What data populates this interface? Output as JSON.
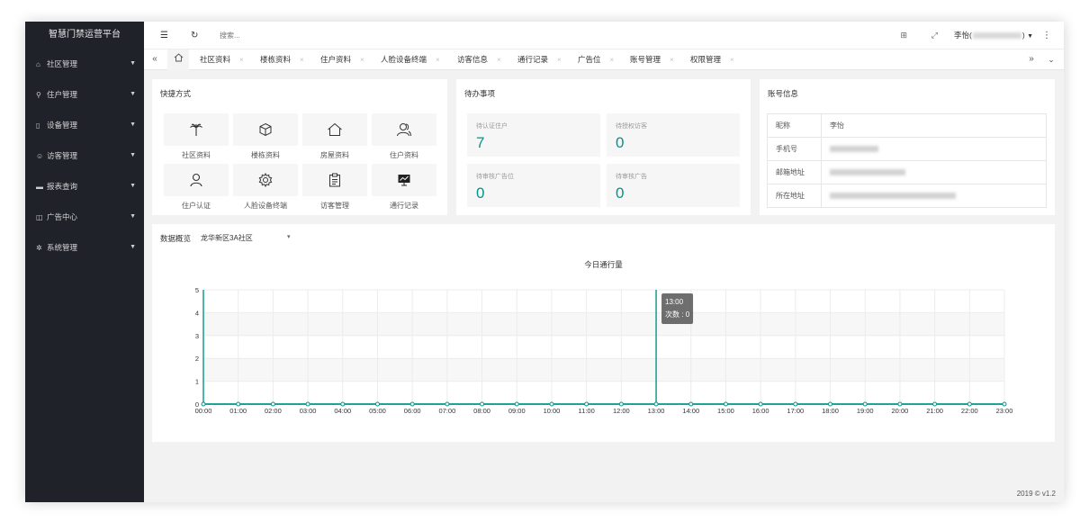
{
  "app": {
    "title": "智慧门禁运营平台",
    "footer": "2019 © v1.2"
  },
  "sidebar": {
    "items": [
      {
        "label": "社区管理",
        "icon": "home-icon"
      },
      {
        "label": "住户管理",
        "icon": "user-icon"
      },
      {
        "label": "设备管理",
        "icon": "tablet-icon"
      },
      {
        "label": "访客管理",
        "icon": "visitors-icon"
      },
      {
        "label": "报表查询",
        "icon": "report-icon"
      },
      {
        "label": "广告中心",
        "icon": "ad-icon"
      },
      {
        "label": "系统管理",
        "icon": "gear-icon"
      }
    ]
  },
  "header": {
    "search_placeholder": "搜索...",
    "user_name": "李怡(",
    "user_suffix": ")"
  },
  "tabs": [
    "社区资料",
    "楼栋资料",
    "住户资料",
    "人脸设备终端",
    "访客信息",
    "通行记录",
    "广告位",
    "账号管理",
    "权限管理"
  ],
  "quick": {
    "title": "快捷方式",
    "items": [
      {
        "label": "社区资料",
        "icon": "palm-tree-icon"
      },
      {
        "label": "楼栋资料",
        "icon": "cube-icon"
      },
      {
        "label": "房屋资料",
        "icon": "house-icon"
      },
      {
        "label": "住户资料",
        "icon": "users-icon"
      },
      {
        "label": "住户认证",
        "icon": "person-icon"
      },
      {
        "label": "人脸设备终端",
        "icon": "gear-icon"
      },
      {
        "label": "访客管理",
        "icon": "clipboard-icon"
      },
      {
        "label": "通行记录",
        "icon": "presentation-icon"
      }
    ]
  },
  "todo": {
    "title": "待办事项",
    "items": [
      {
        "label": "待认证住户",
        "value": "7"
      },
      {
        "label": "待授权访客",
        "value": "0"
      },
      {
        "label": "待审核广告位",
        "value": "0"
      },
      {
        "label": "待审核广告",
        "value": "0"
      }
    ]
  },
  "account": {
    "title": "账号信息",
    "rows": [
      {
        "key": "昵称",
        "value": "李怡"
      },
      {
        "key": "手机号",
        "value": ""
      },
      {
        "key": "邮箱地址",
        "value": ""
      },
      {
        "key": "所在地址",
        "value": ""
      }
    ]
  },
  "overview": {
    "title": "数据概览",
    "community": "龙华新区3A社区"
  },
  "chart_data": {
    "type": "line",
    "title": "今日通行量",
    "x": [
      "00:00",
      "01:00",
      "02:00",
      "03:00",
      "04:00",
      "05:00",
      "06:00",
      "07:00",
      "08:00",
      "09:00",
      "10:00",
      "11:00",
      "12:00",
      "13:00",
      "14:00",
      "15:00",
      "16:00",
      "17:00",
      "18:00",
      "19:00",
      "20:00",
      "21:00",
      "22:00",
      "23:00"
    ],
    "series": [
      {
        "values": [
          0,
          0,
          0,
          0,
          0,
          0,
          0,
          0,
          0,
          0,
          0,
          0,
          0,
          0,
          0,
          0,
          0,
          0,
          0,
          0,
          0,
          0,
          0,
          0
        ]
      }
    ],
    "ylim": [
      0,
      5
    ],
    "yticks": [
      0,
      1,
      2,
      3,
      4,
      5
    ],
    "grid": true,
    "color": "#009688",
    "tooltip": {
      "time": "13:00",
      "text": "次数 : 0"
    }
  }
}
